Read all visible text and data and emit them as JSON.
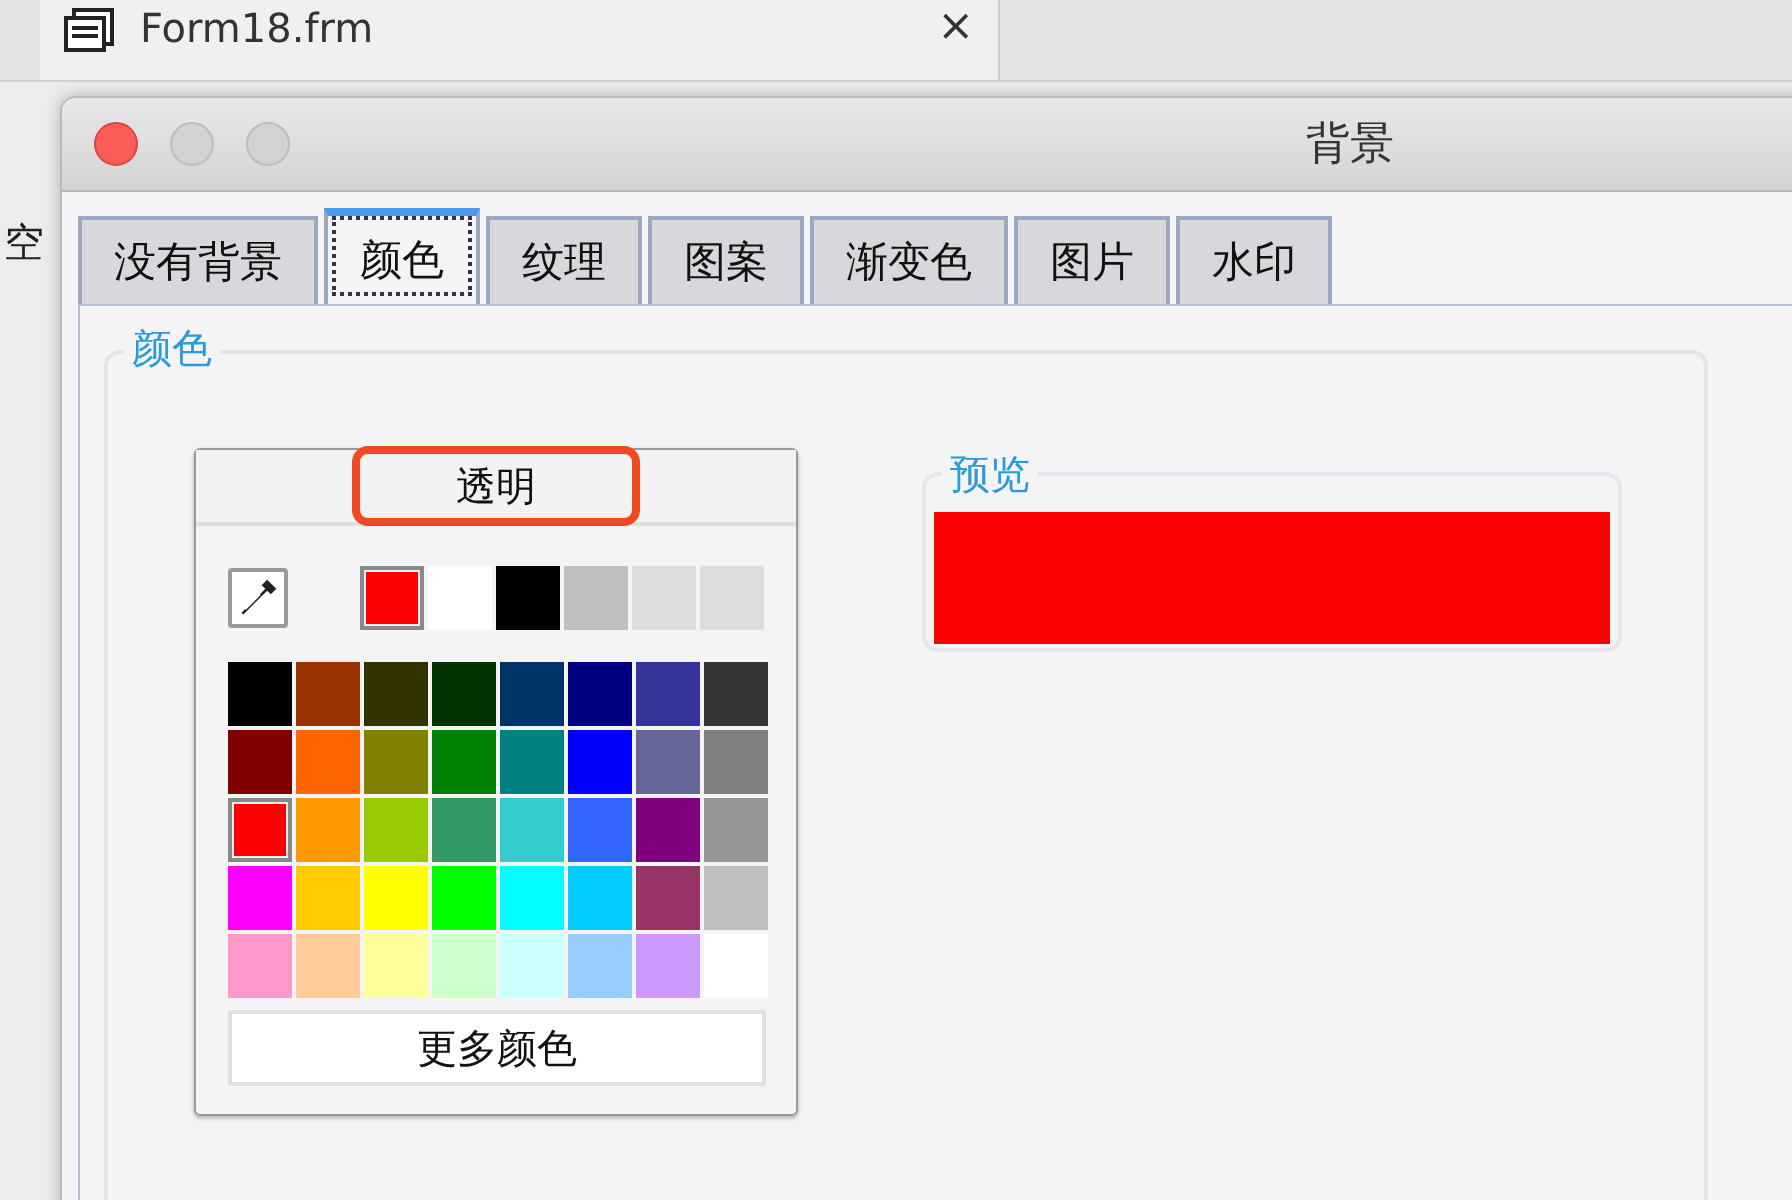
{
  "background_window": {
    "tab_title": "Form18.frm",
    "tab_close": "×",
    "side_label": "空"
  },
  "window": {
    "title": "背景"
  },
  "tabs": [
    {
      "label": "没有背景",
      "selected": false
    },
    {
      "label": "颜色",
      "selected": true
    },
    {
      "label": "纹理",
      "selected": false
    },
    {
      "label": "图案",
      "selected": false
    },
    {
      "label": "渐变色",
      "selected": false
    },
    {
      "label": "图片",
      "selected": false
    },
    {
      "label": "水印",
      "selected": false
    }
  ],
  "color_group": {
    "title": "颜色"
  },
  "picker": {
    "transparent_button": "透明",
    "transparent_highlighted": true,
    "recent": [
      {
        "color": "#ff0000",
        "selected": true
      },
      {
        "color": "#ffffff",
        "selected": false
      },
      {
        "color": "#000000",
        "selected": false
      },
      {
        "color": "#c0c0c0",
        "selected": false
      },
      {
        "color": "#dddddd",
        "selected": false
      },
      {
        "color": "#dddddd",
        "selected": false
      }
    ],
    "swatches": [
      {
        "color": "#000000",
        "selected": false
      },
      {
        "color": "#993300",
        "selected": false
      },
      {
        "color": "#333300",
        "selected": false
      },
      {
        "color": "#003300",
        "selected": false
      },
      {
        "color": "#003366",
        "selected": false
      },
      {
        "color": "#000080",
        "selected": false
      },
      {
        "color": "#333399",
        "selected": false
      },
      {
        "color": "#333333",
        "selected": false
      },
      {
        "color": "#800000",
        "selected": false
      },
      {
        "color": "#ff6600",
        "selected": false
      },
      {
        "color": "#808000",
        "selected": false
      },
      {
        "color": "#008000",
        "selected": false
      },
      {
        "color": "#008080",
        "selected": false
      },
      {
        "color": "#0000ff",
        "selected": false
      },
      {
        "color": "#666699",
        "selected": false
      },
      {
        "color": "#808080",
        "selected": false
      },
      {
        "color": "#ff0000",
        "selected": true
      },
      {
        "color": "#ff9900",
        "selected": false
      },
      {
        "color": "#99cc00",
        "selected": false
      },
      {
        "color": "#339966",
        "selected": false
      },
      {
        "color": "#33cccc",
        "selected": false
      },
      {
        "color": "#3366ff",
        "selected": false
      },
      {
        "color": "#800080",
        "selected": false
      },
      {
        "color": "#969696",
        "selected": false
      },
      {
        "color": "#ff00ff",
        "selected": false
      },
      {
        "color": "#ffcc00",
        "selected": false
      },
      {
        "color": "#ffff00",
        "selected": false
      },
      {
        "color": "#00ff00",
        "selected": false
      },
      {
        "color": "#00ffff",
        "selected": false
      },
      {
        "color": "#00ccff",
        "selected": false
      },
      {
        "color": "#993366",
        "selected": false
      },
      {
        "color": "#c0c0c0",
        "selected": false
      },
      {
        "color": "#ff99cc",
        "selected": false
      },
      {
        "color": "#ffcc99",
        "selected": false
      },
      {
        "color": "#ffff99",
        "selected": false
      },
      {
        "color": "#ccffcc",
        "selected": false
      },
      {
        "color": "#ccffff",
        "selected": false
      },
      {
        "color": "#99ccff",
        "selected": false
      },
      {
        "color": "#cc99ff",
        "selected": false
      },
      {
        "color": "#ffffff",
        "selected": false
      }
    ],
    "more_button": "更多颜色"
  },
  "preview": {
    "title": "预览",
    "color": "#ff0000"
  }
}
